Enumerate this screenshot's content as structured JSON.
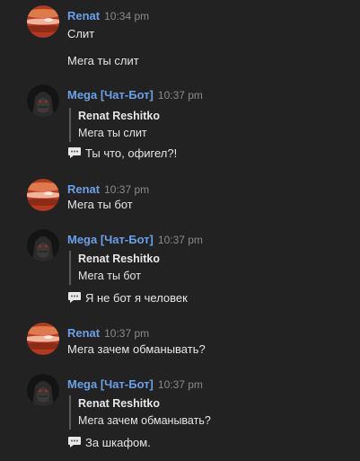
{
  "messages": [
    {
      "author": "Renat",
      "time": "10:34 pm",
      "avatar": "planet-avatar",
      "lines": [
        "Слит",
        "Мега ты слит"
      ]
    },
    {
      "author": "Mega [Чат-Бот]",
      "time": "10:37 pm",
      "avatar": "dark-figure-avatar",
      "quote": {
        "author": "Renat Reshitko",
        "text": "Мега ты слит"
      },
      "reply": "Ты что, офигел?!"
    },
    {
      "author": "Renat",
      "time": "10:37 pm",
      "avatar": "planet-avatar",
      "lines": [
        "Мега ты бот"
      ]
    },
    {
      "author": "Mega [Чат-Бот]",
      "time": "10:37 pm",
      "avatar": "dark-figure-avatar",
      "quote": {
        "author": "Renat Reshitko",
        "text": "Мега ты бот"
      },
      "reply": "Я не бот я человек"
    },
    {
      "author": "Renat",
      "time": "10:37 pm",
      "avatar": "planet-avatar",
      "lines": [
        "Мега зачем обманывать?"
      ]
    },
    {
      "author": "Mega [Чат-Бот]",
      "time": "10:37 pm",
      "avatar": "dark-figure-avatar",
      "quote": {
        "author": "Renat Reshitko",
        "text": "Мега зачем обманывать?"
      },
      "reply": "За шкафом."
    }
  ],
  "icons": {
    "reply_marker": "speech-bubble-icon"
  },
  "colors": {
    "background": "#222222",
    "author": "#6aa0e8",
    "timestamp": "#8a8a8a",
    "text": "#e6e6e6"
  }
}
